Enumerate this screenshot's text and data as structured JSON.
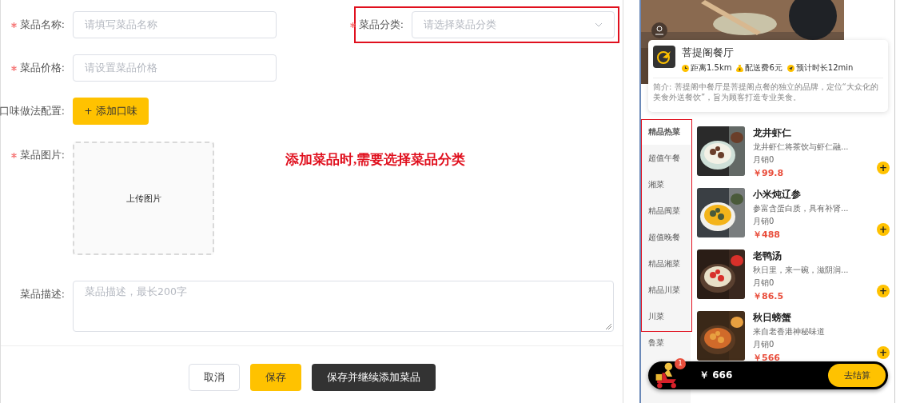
{
  "form": {
    "fields": [
      {
        "kind": "input",
        "label": "菜品名称:",
        "required": true,
        "placeholder": "请填写菜品名称",
        "highlighted": false
      },
      {
        "kind": "select",
        "label": "菜品分类:",
        "required": true,
        "placeholder": "请选择菜品分类",
        "highlighted": true
      },
      {
        "kind": "input",
        "label": "菜品价格:",
        "required": true,
        "placeholder": "请设置菜品价格",
        "highlighted": false
      },
      {
        "kind": "button",
        "label": "口味做法配置:",
        "required": false,
        "button": "+ 添加口味",
        "highlighted": false
      },
      {
        "kind": "upload",
        "label": "菜品图片:",
        "required": true,
        "button": "上传图片",
        "highlighted": false
      },
      {
        "kind": "textarea",
        "label": "菜品描述:",
        "required": false,
        "placeholder": "菜品描述，最长200字",
        "highlighted": false
      }
    ],
    "note": "添加菜品时,需要选择菜品分类",
    "buttons": [
      {
        "kind": "plain",
        "label": "取消"
      },
      {
        "kind": "primary",
        "label": "保存"
      },
      {
        "kind": "dark",
        "label": "保存并继续添加菜品"
      }
    ]
  },
  "phone": {
    "shop": {
      "name": "菩提阁餐厅",
      "meta": [
        {
          "kind": "distance",
          "text": "距离1.5km"
        },
        {
          "kind": "fee",
          "text": "配送费6元"
        },
        {
          "kind": "time",
          "text": "预计时长12min"
        }
      ],
      "intro": "简介: 菩提阁中餐厅是菩提阁点餐的独立的品牌，定位“大众化的美食外送餐饮”，旨为顾客打造专业美食。"
    },
    "categories_highlighted": true,
    "categories": [
      {
        "label": "精品热菜",
        "selected": true
      },
      {
        "label": "超值午餐",
        "selected": false
      },
      {
        "label": "湘菜",
        "selected": false
      },
      {
        "label": "精品闽菜",
        "selected": false
      },
      {
        "label": "超值晚餐",
        "selected": false
      },
      {
        "label": "精品湘菜",
        "selected": false
      },
      {
        "label": "精品川菜",
        "selected": false
      },
      {
        "label": "川菜",
        "selected": false
      },
      {
        "label": "鲁菜",
        "selected": false
      }
    ],
    "dishes": [
      {
        "name": "龙井虾仁",
        "desc": "龙井虾仁将茶饮与虾仁融...",
        "sales": "月销0",
        "price": "￥99.8",
        "add": "+"
      },
      {
        "name": "小米炖辽参",
        "desc": "参富含蛋白质，具有补肾...",
        "sales": "月销0",
        "price": "￥488",
        "add": "+"
      },
      {
        "name": "老鸭汤",
        "desc": "秋日里，来一碗，滋阴润...",
        "sales": "月销0",
        "price": "￥86.5",
        "add": "+"
      },
      {
        "name": "秋日螃蟹",
        "desc": "来自老香港神秘味道",
        "sales": "月销0",
        "price": "￥566",
        "add": "+"
      }
    ],
    "cart": {
      "count": "1",
      "total": "￥ 666",
      "checkout": "去结算"
    }
  }
}
